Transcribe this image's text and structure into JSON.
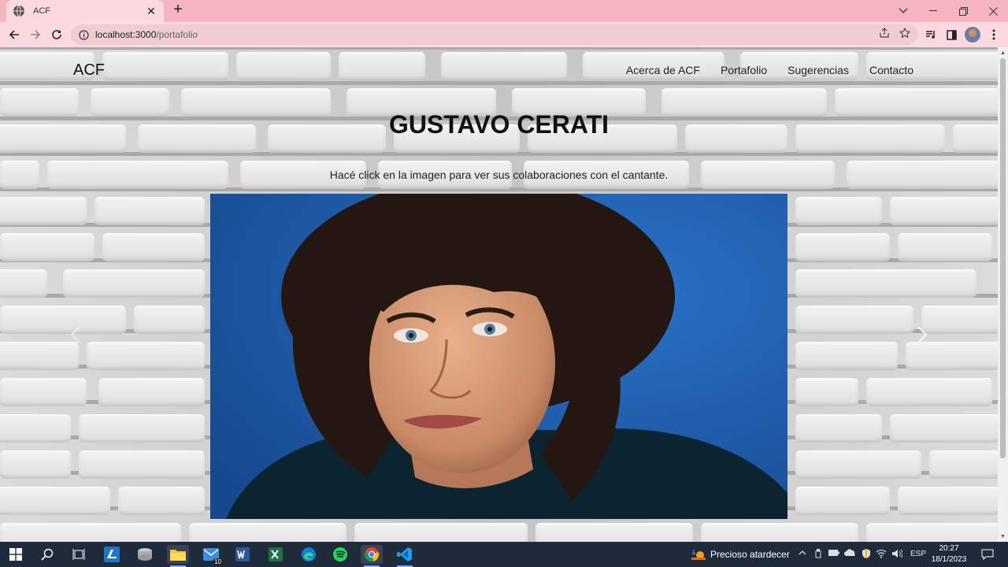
{
  "browser": {
    "tab": {
      "title": "ACF"
    },
    "url": {
      "host": "localhost:3000",
      "path": "/portafolio"
    }
  },
  "site": {
    "brand": "ACF",
    "nav": [
      {
        "label": "Acerca de ACF"
      },
      {
        "label": "Portafolio"
      },
      {
        "label": "Sugerencias"
      },
      {
        "label": "Contacto"
      }
    ],
    "heading": "GUSTAVO CERATI",
    "subtitle": "Hacé click en la imagen para ver sus colaboraciones con el cantante."
  },
  "taskbar": {
    "mail_badge": "10",
    "weather": "Precioso atardecer",
    "language": "ESP",
    "time": "20:27",
    "date": "18/1/2023"
  },
  "colors": {
    "tab_strip": "#f6b4c0",
    "toolbar": "#fbd9df",
    "taskbar": "#1f2a3a",
    "photo_background": "#1e63b6"
  }
}
